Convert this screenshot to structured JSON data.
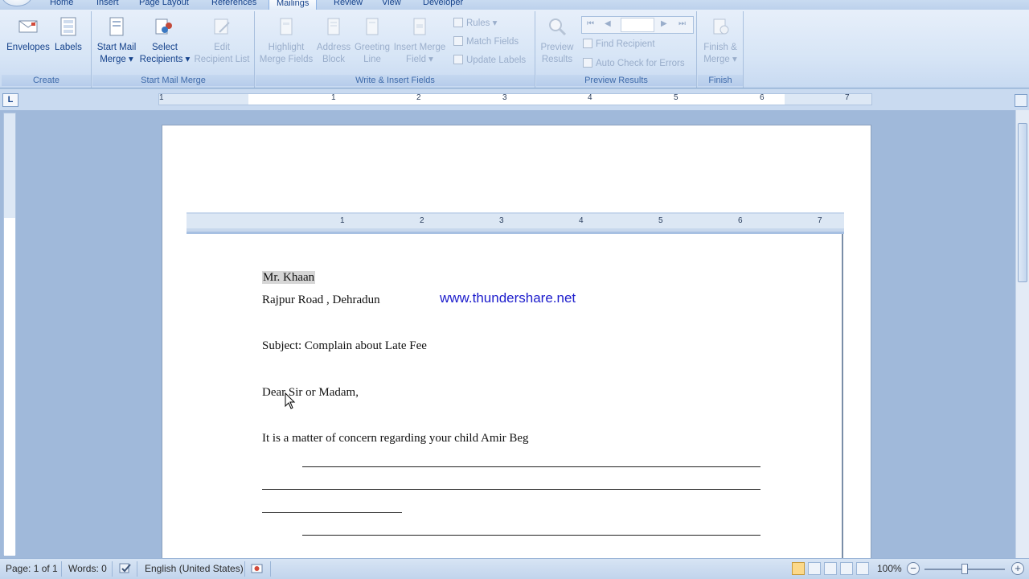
{
  "tabs": [
    "Home",
    "Insert",
    "Page Layout",
    "References",
    "Mailings",
    "Review",
    "View",
    "Developer"
  ],
  "active_tab": "Mailings",
  "ribbon": {
    "create": {
      "label": "Create",
      "envelopes": "Envelopes",
      "labels": "Labels"
    },
    "start_mail_merge": {
      "label": "Start Mail Merge",
      "start_line1": "Start Mail",
      "start_line2": "Merge ▾",
      "select_line1": "Select",
      "select_line2": "Recipients ▾",
      "edit_line1": "Edit",
      "edit_line2": "Recipient List"
    },
    "write_insert": {
      "label": "Write & Insert Fields",
      "highlight_line1": "Highlight",
      "highlight_line2": "Merge Fields",
      "address_line1": "Address",
      "address_line2": "Block",
      "greeting_line1": "Greeting",
      "greeting_line2": "Line",
      "insert_line1": "Insert Merge",
      "insert_line2": "Field ▾",
      "rules": "Rules ▾",
      "match_fields": "Match Fields",
      "update_labels": "Update Labels"
    },
    "preview": {
      "label": "Preview Results",
      "preview_line1": "Preview",
      "preview_line2": "Results",
      "find_recipient": "Find Recipient",
      "auto_check": "Auto Check for Errors",
      "record_value": ""
    },
    "finish": {
      "label": "Finish",
      "finish_line1": "Finish &",
      "finish_line2": "Merge ▾"
    }
  },
  "ruler_numbers": [
    "1",
    "1",
    "2",
    "3",
    "4",
    "5",
    "6",
    "7"
  ],
  "inner_ruler_numbers": [
    "1",
    "2",
    "3",
    "4",
    "5",
    "6",
    "7"
  ],
  "document": {
    "recipient_name": "Mr. Khaan",
    "address": "Rajpur Road , Dehradun",
    "watermark": "www.thundershare.net",
    "subject": "Subject: Complain about Late Fee",
    "salutation": "Dear Sir or Madam,",
    "body_line": "It is a matter of concern regarding your child Amir Beg"
  },
  "status_bar": {
    "page": "Page: 1 of 1",
    "words": "Words: 0",
    "language": "English (United States)",
    "zoom": "100%"
  },
  "colors": {
    "ribbon_bg": "#dbe7f6",
    "workspace_bg": "#a0b9da",
    "watermark": "#1c1ccc",
    "field_highlight": "#d6d6d6"
  }
}
